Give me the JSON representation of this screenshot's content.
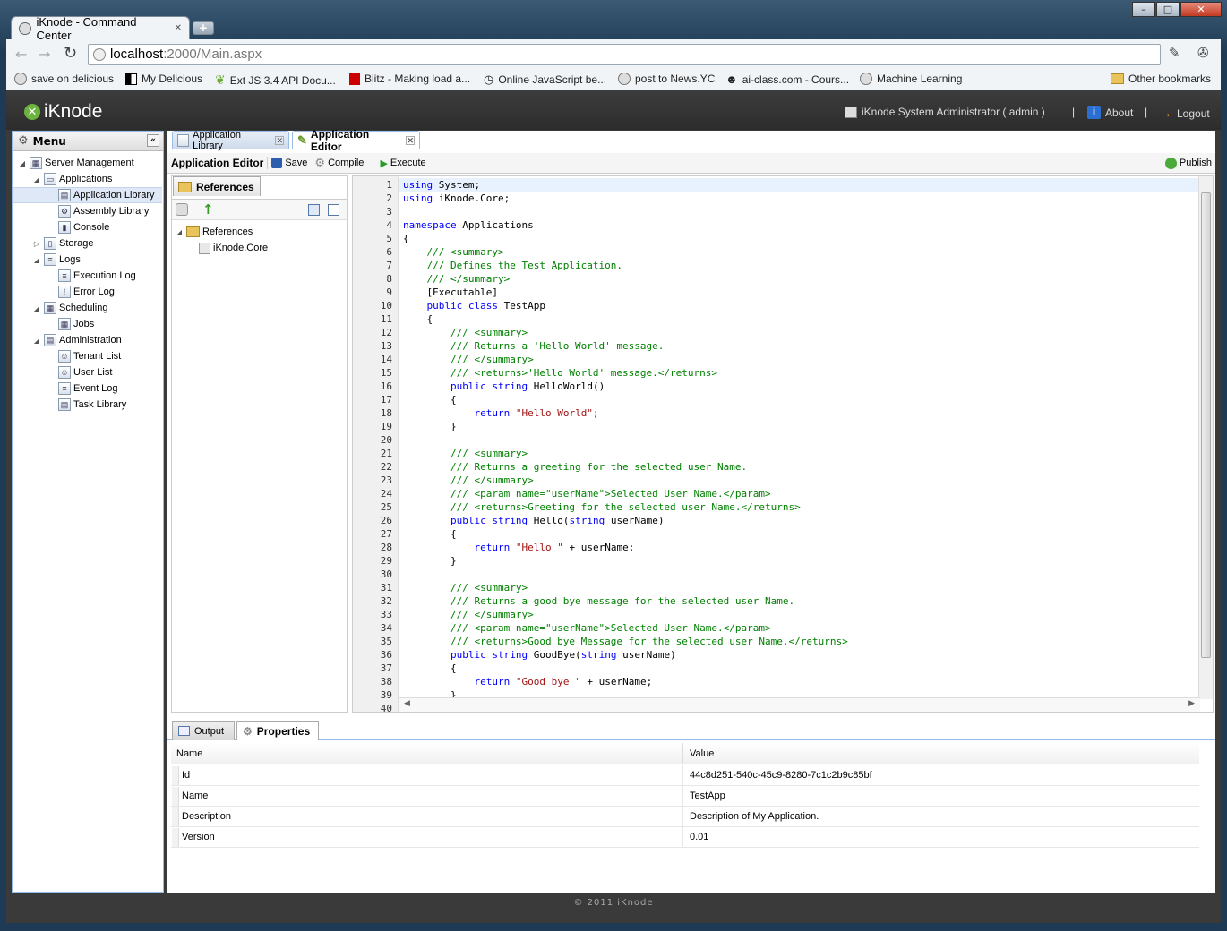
{
  "browser": {
    "tab_title": "iKnode - Command Center",
    "url_host": "localhost",
    "url_rest": ":2000/Main.aspx",
    "bookmarks": [
      {
        "label": "save on delicious",
        "icon": "globe-icon"
      },
      {
        "label": "My Delicious",
        "icon": "delicious-icon"
      },
      {
        "label": "Ext JS 3.4 API Docu...",
        "icon": "leaf-icon"
      },
      {
        "label": "Blitz - Making load a...",
        "icon": "bars-icon"
      },
      {
        "label": "Online JavaScript be...",
        "icon": "clock-icon"
      },
      {
        "label": "post to News.YC",
        "icon": "globe-icon"
      },
      {
        "label": "ai-class.com - Cours...",
        "icon": "robot-icon"
      },
      {
        "label": "Machine Learning",
        "icon": "globe-icon"
      }
    ],
    "other_bookmarks": "Other bookmarks"
  },
  "header": {
    "logo": "iKnode",
    "user": "iKnode System Administrator ( admin )",
    "about": "About",
    "logout": "Logout",
    "separator": "|"
  },
  "menu": {
    "title": "Menu",
    "items": [
      {
        "label": "Server Management",
        "level": 0,
        "expanded": true,
        "icon": "server-icon"
      },
      {
        "label": "Applications",
        "level": 1,
        "expanded": true,
        "icon": "window-icon"
      },
      {
        "label": "Application Library",
        "level": 2,
        "icon": "app-library-icon",
        "selected": true
      },
      {
        "label": "Assembly Library",
        "level": 2,
        "icon": "assembly-icon"
      },
      {
        "label": "Console",
        "level": 2,
        "icon": "console-icon"
      },
      {
        "label": "Storage",
        "level": 1,
        "expanded": false,
        "icon": "storage-icon"
      },
      {
        "label": "Logs",
        "level": 1,
        "expanded": true,
        "icon": "logs-icon"
      },
      {
        "label": "Execution Log",
        "level": 2,
        "icon": "execution-log-icon"
      },
      {
        "label": "Error Log",
        "level": 2,
        "icon": "error-log-icon"
      },
      {
        "label": "Scheduling",
        "level": 1,
        "expanded": true,
        "icon": "calendar-icon"
      },
      {
        "label": "Jobs",
        "level": 2,
        "icon": "jobs-icon"
      },
      {
        "label": "Administration",
        "level": 1,
        "expanded": true,
        "icon": "admin-icon"
      },
      {
        "label": "Tenant List",
        "level": 2,
        "icon": "tenant-icon"
      },
      {
        "label": "User List",
        "level": 2,
        "icon": "users-icon"
      },
      {
        "label": "Event Log",
        "level": 2,
        "icon": "event-log-icon"
      },
      {
        "label": "Task Library",
        "level": 2,
        "icon": "task-library-icon"
      }
    ]
  },
  "tabs": [
    {
      "label": "Application Library",
      "active": false
    },
    {
      "label": "Application Editor",
      "active": true
    }
  ],
  "editor_toolbar": {
    "title": "Application Editor",
    "save": "Save",
    "compile": "Compile",
    "execute": "Execute",
    "publish": "Publish"
  },
  "references": {
    "tab": "References",
    "root": "References",
    "children": [
      "iKnode.Core"
    ]
  },
  "code": {
    "lines": [
      "using System;",
      "using iKnode.Core;",
      "",
      "namespace Applications",
      "{",
      "    /// <summary>",
      "    /// Defines the Test Application.",
      "    /// </summary>",
      "    [Executable]",
      "    public class TestApp",
      "    {",
      "        /// <summary>",
      "        /// Returns a 'Hello World' message.",
      "        /// </summary>",
      "        /// <returns>'Hello World' message.</returns>",
      "        public string HelloWorld()",
      "        {",
      "            return \"Hello World\";",
      "        }",
      "",
      "        /// <summary>",
      "        /// Returns a greeting for the selected user Name.",
      "        /// </summary>",
      "        /// <param name=\"userName\">Selected User Name.</param>",
      "        /// <returns>Greeting for the selected user Name.</returns>",
      "        public string Hello(string userName)",
      "        {",
      "            return \"Hello \" + userName;",
      "        }",
      "",
      "        /// <summary>",
      "        /// Returns a good bye message for the selected user Name.",
      "        /// </summary>",
      "        /// <param name=\"userName\">Selected User Name.</param>",
      "        /// <returns>Good bye Message for the selected user Name.</returns>",
      "        public string GoodBye(string userName)",
      "        {",
      "            return \"Good bye \" + userName;",
      "        }",
      ""
    ]
  },
  "bottom_tabs": [
    {
      "label": "Output",
      "active": false
    },
    {
      "label": "Properties",
      "active": true
    }
  ],
  "properties": {
    "headers": [
      "Name",
      "Value"
    ],
    "rows": [
      [
        "Id",
        "44c8d251-540c-45c9-8280-7c1c2b9c85bf"
      ],
      [
        "Name",
        "TestApp"
      ],
      [
        "Description",
        "Description of My Application."
      ],
      [
        "Version",
        "0.01"
      ]
    ]
  },
  "footer": "© 2011 iKnode"
}
